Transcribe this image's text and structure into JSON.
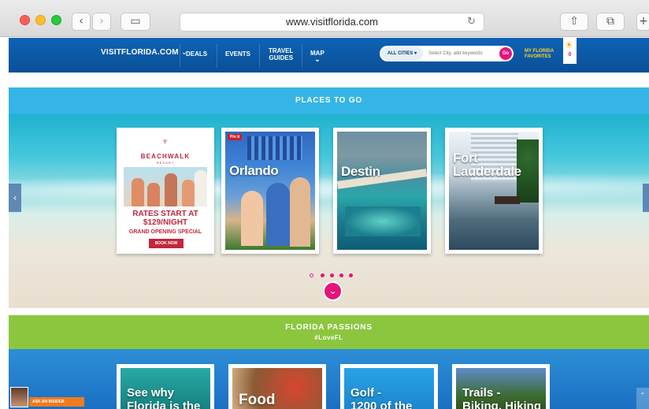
{
  "browser": {
    "url": "www.visitflorida.com",
    "back_icon": "‹",
    "forward_icon": "›",
    "sidebar_icon": "▭",
    "reload_icon": "↻",
    "share_icon": "⇧",
    "tabs_icon": "⧉",
    "newtab_icon": "+"
  },
  "header": {
    "logo_text": "VISITFLORIDA.COM",
    "logo_chevron": "⌄",
    "nav": [
      {
        "label": "DEALS"
      },
      {
        "label": "EVENTS"
      },
      {
        "label": "TRAVEL\nGUIDES"
      },
      {
        "label": "MAP"
      }
    ],
    "map_chevron": "⌄",
    "search": {
      "cities_label": "ALL CITIES ▾",
      "placeholder": "Select City, add keywords",
      "go_label": "Go"
    },
    "favorites_label": "MY FLORIDA\nFAVORITES",
    "favorites_count": "0"
  },
  "places": {
    "heading": "PLACES TO GO",
    "ad": {
      "brand": "BEACHWALK",
      "resort": "RESORT",
      "rate": "RATES START AT\n$129/NIGHT",
      "special": "GRAND OPENING SPECIAL",
      "cta": "BOOK NOW"
    },
    "cards": [
      {
        "label": "Orlando",
        "pin": "Pin it"
      },
      {
        "label": "Destin"
      },
      {
        "label": "Fort\nLauderdale"
      }
    ],
    "carousel_total": 5,
    "carousel_active": 1
  },
  "passions": {
    "heading": "FLORIDA PASSIONS",
    "hashtag": "#LoveFL",
    "cards": [
      {
        "label": "See why\nFlorida is the"
      },
      {
        "label": "Food"
      },
      {
        "label": "Golf -\n1200 of the"
      },
      {
        "label": "Trails -\nBiking, Hiking"
      }
    ]
  },
  "insider": {
    "label": "ASK AN INSIDER"
  },
  "colors": {
    "brand_blue": "#0e63b6",
    "places_band": "#35b5e7",
    "passions_band": "#8cc63f",
    "accent_pink": "#e5157a"
  }
}
